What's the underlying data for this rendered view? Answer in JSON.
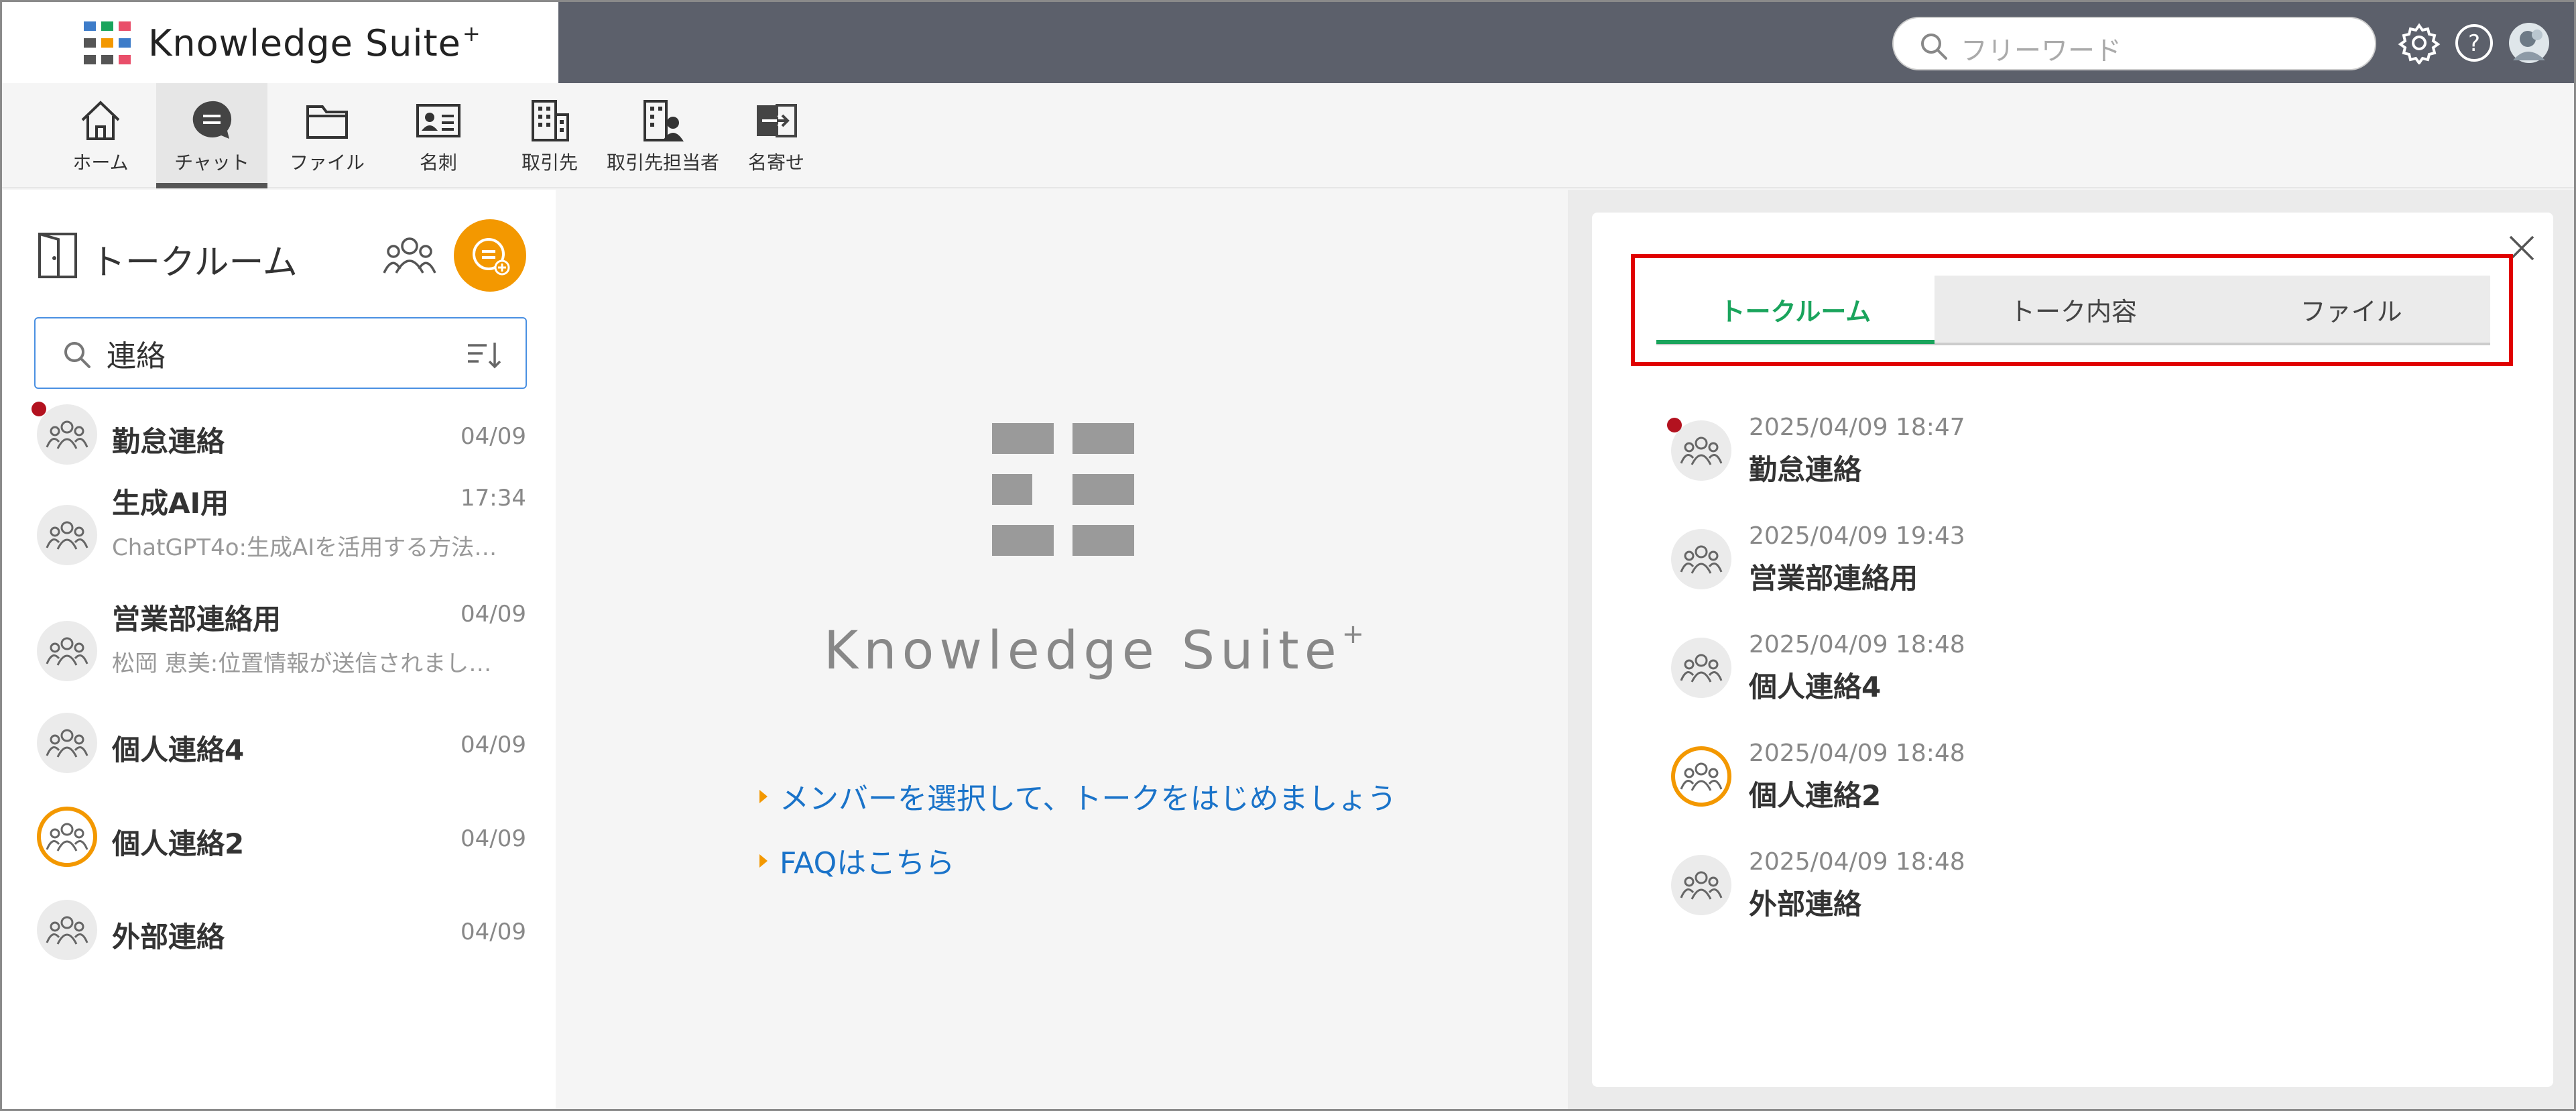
{
  "app": {
    "brand": "Knowledge Suite",
    "brand_mark": "+",
    "search_placeholder": "フリーワード",
    "accent": "#f39800",
    "topbar_color": "#5c606b",
    "link_color": "#1a73c9",
    "active_tab_color": "#1aa45c",
    "highlight_color": "#e00000"
  },
  "top_icons": [
    "gear-icon",
    "help-icon",
    "user-avatar"
  ],
  "nav": [
    {
      "label": "ホーム",
      "icon": "home-icon"
    },
    {
      "label": "チャット",
      "icon": "chat-icon",
      "active": true
    },
    {
      "label": "ファイル",
      "icon": "folder-icon"
    },
    {
      "label": "名刺",
      "icon": "business-card-icon"
    },
    {
      "label": "取引先",
      "icon": "building-icon"
    },
    {
      "label": "取引先担当者",
      "icon": "building-person-icon"
    },
    {
      "label": "名寄せ",
      "icon": "merge-icon"
    }
  ],
  "left": {
    "title": "トークルーム",
    "search_value": "連絡",
    "rooms": [
      {
        "name": "勤怠連絡",
        "date": "04/09",
        "snippet": "",
        "unread": true,
        "orange": false
      },
      {
        "name": "生成AI用",
        "date": "17:34",
        "snippet": "ChatGPT4o:生成AIを活用する方法…",
        "unread": false,
        "orange": false
      },
      {
        "name": "営業部連絡用",
        "date": "04/09",
        "snippet": "松岡 恵美:位置情報が送信されまし…",
        "unread": false,
        "orange": false
      },
      {
        "name": "個人連絡4",
        "date": "04/09",
        "snippet": "",
        "unread": false,
        "orange": false
      },
      {
        "name": "個人連絡2",
        "date": "04/09",
        "snippet": "",
        "unread": false,
        "orange": true
      },
      {
        "name": "外部連絡",
        "date": "04/09",
        "snippet": "",
        "unread": false,
        "orange": false
      }
    ]
  },
  "center": {
    "brand": "Knowledge Suite",
    "brand_mark": "+",
    "links": [
      "メンバーを選択して、トークをはじめましょう",
      "FAQはこちら"
    ]
  },
  "right": {
    "tabs": [
      "トークルーム",
      "トーク内容",
      "ファイル"
    ],
    "active_tab": 0,
    "results": [
      {
        "date": "2025/04/09 18:47",
        "name": "勤怠連絡",
        "unread": true,
        "orange": false
      },
      {
        "date": "2025/04/09 19:43",
        "name": "営業部連絡用",
        "unread": false,
        "orange": false
      },
      {
        "date": "2025/04/09 18:48",
        "name": "個人連絡4",
        "unread": false,
        "orange": false
      },
      {
        "date": "2025/04/09 18:48",
        "name": "個人連絡2",
        "unread": false,
        "orange": true
      },
      {
        "date": "2025/04/09 18:48",
        "name": "外部連絡",
        "unread": false,
        "orange": false
      }
    ]
  }
}
